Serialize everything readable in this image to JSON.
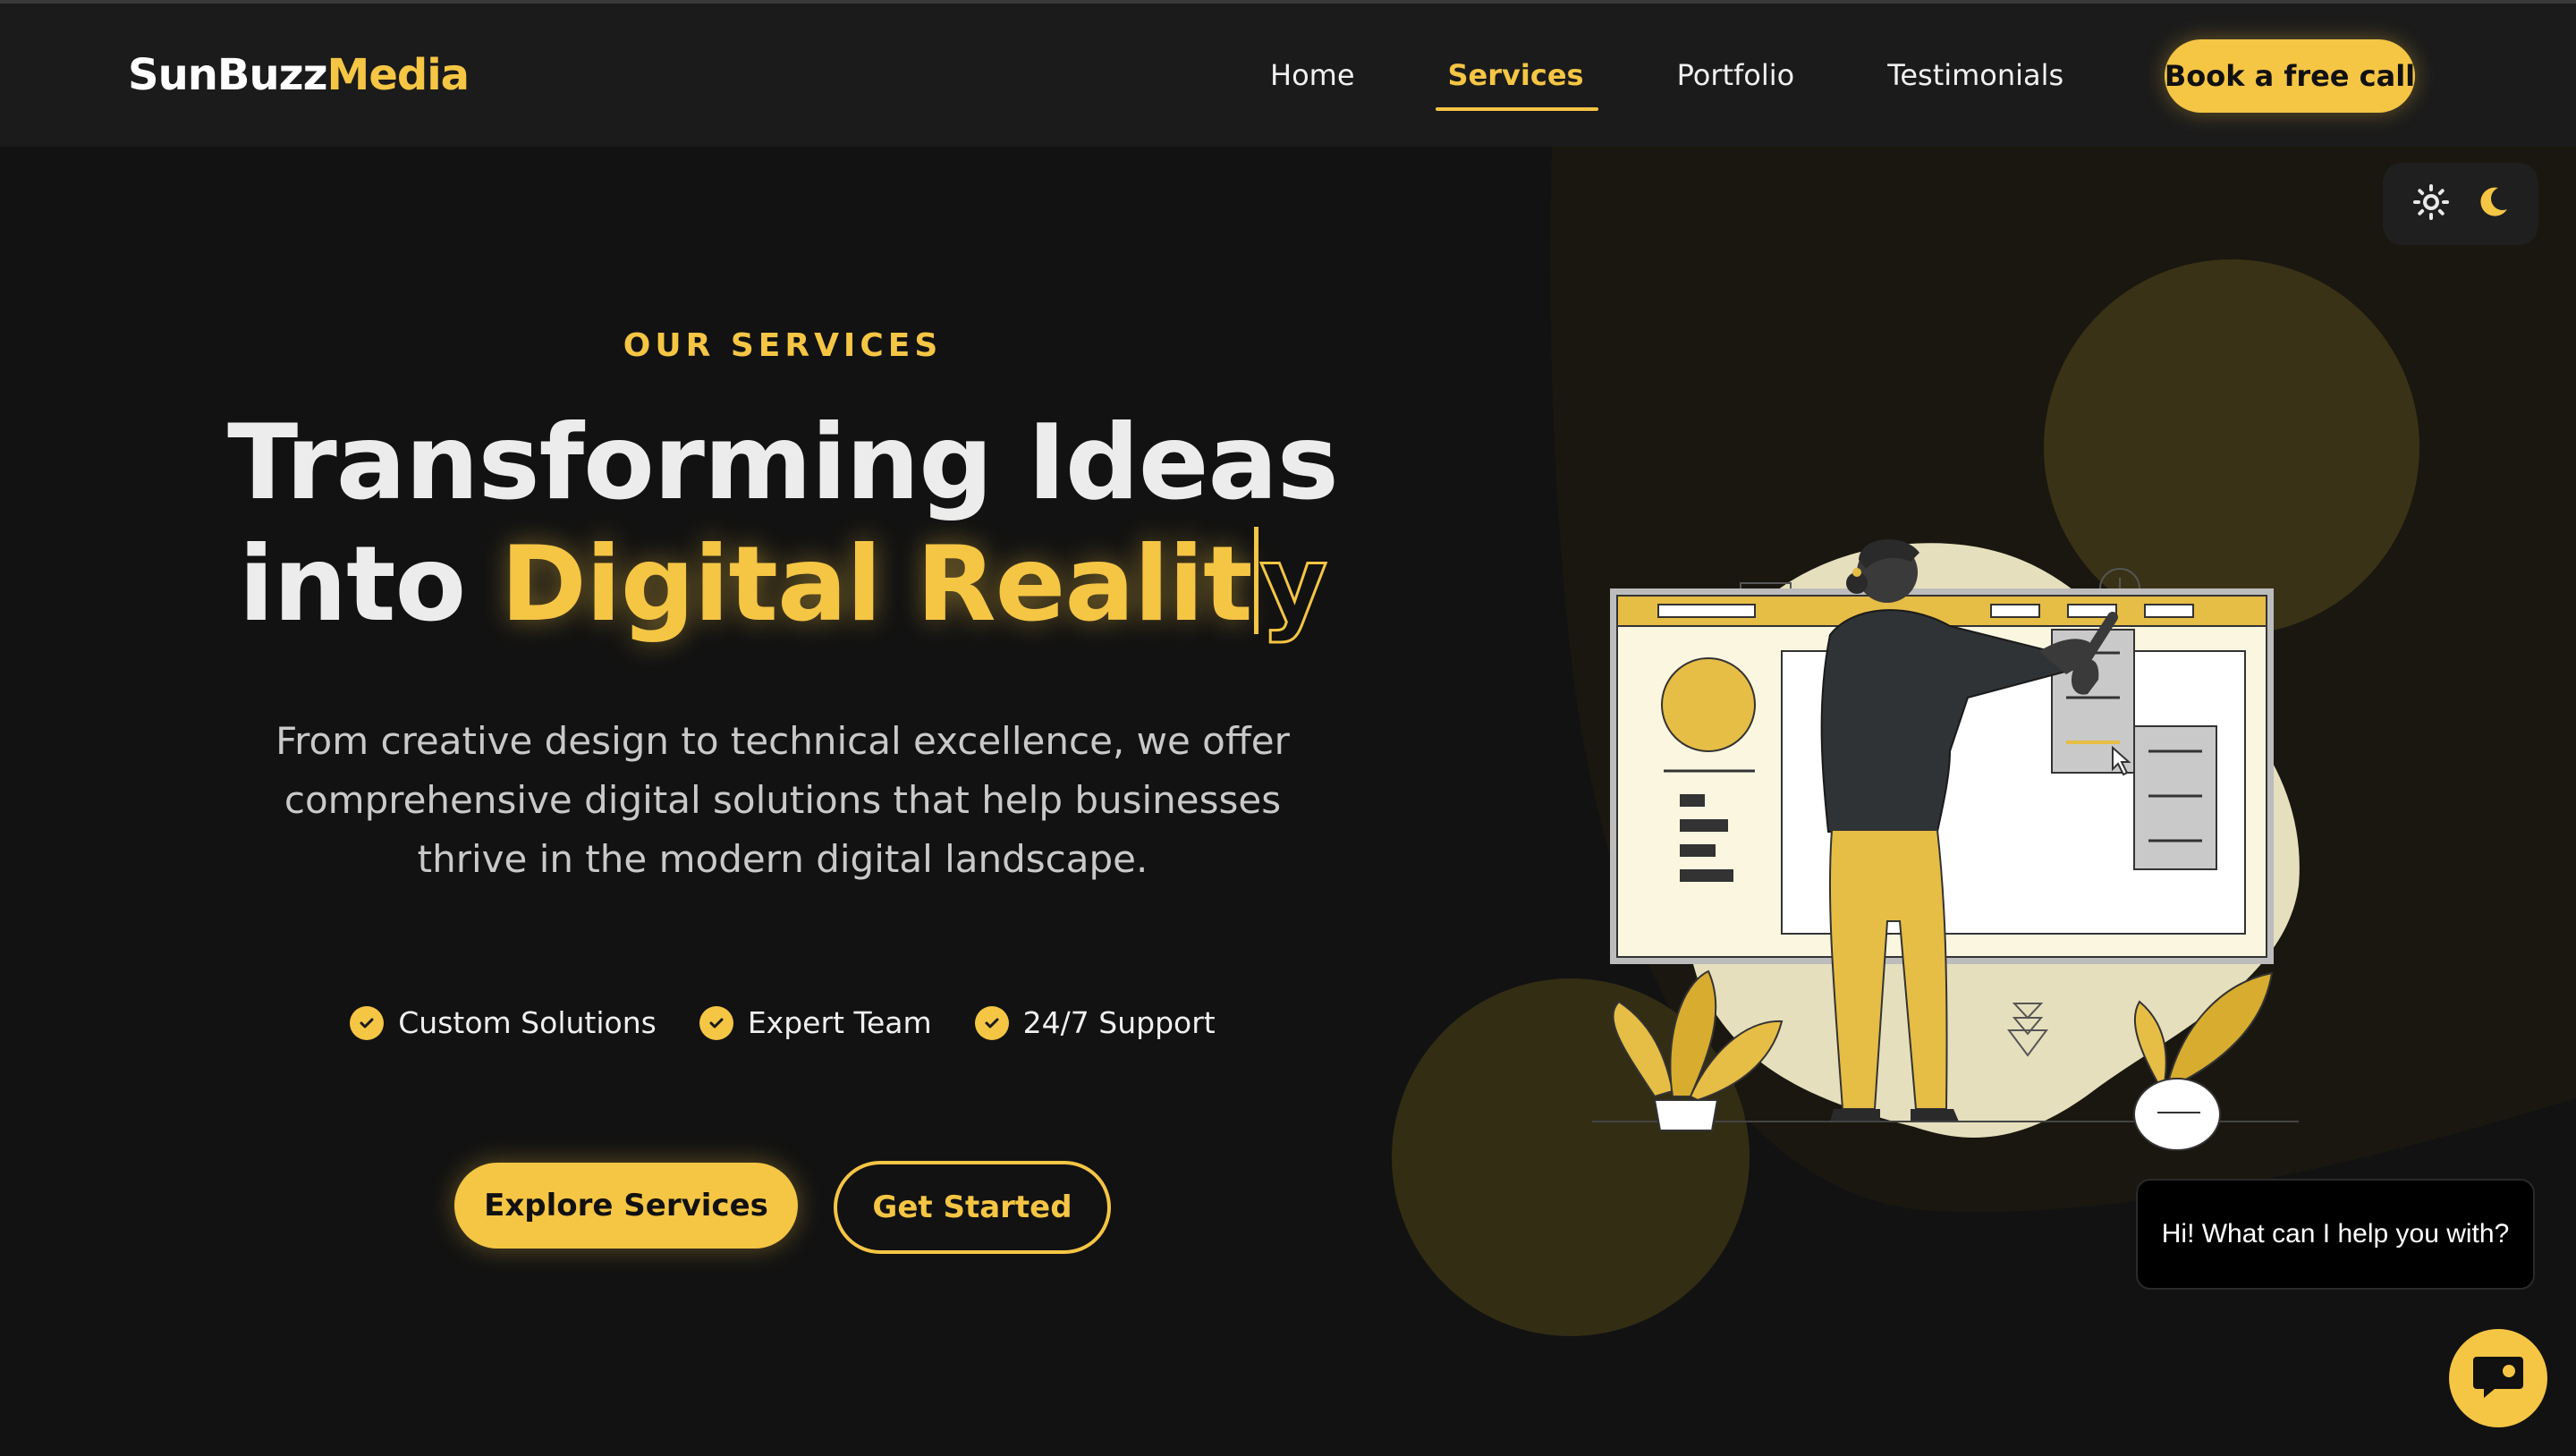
{
  "header": {
    "logo_part1": "SunBuzz",
    "logo_part2": "Media",
    "nav": [
      "Home",
      "Services",
      "Portfolio",
      "Testimonials"
    ],
    "active_nav": "Services",
    "cta": "Book a free call"
  },
  "theme_toggle": {
    "light_icon": "sun-icon",
    "dark_icon": "moon-icon"
  },
  "hero": {
    "eyebrow": "OUR SERVICES",
    "headline_line1": "Transforming Ideas",
    "headline_into": "into",
    "headline_highlight": "Digital Realit",
    "headline_typing_char": "y",
    "description": "From creative design to technical excellence, we offer comprehensive digital solutions that help businesses thrive in the modern digital landscape.",
    "features": [
      "Custom Solutions",
      "Expert Team",
      "24/7 Support"
    ],
    "primary_button": "Explore Services",
    "secondary_button": "Get Started"
  },
  "chat": {
    "greeting": "Hi! What can I help you with?",
    "launcher_icon": "chat-icon"
  },
  "colors": {
    "accent": "#f5c544",
    "background": "#121212",
    "header": "#1b1b1b"
  }
}
